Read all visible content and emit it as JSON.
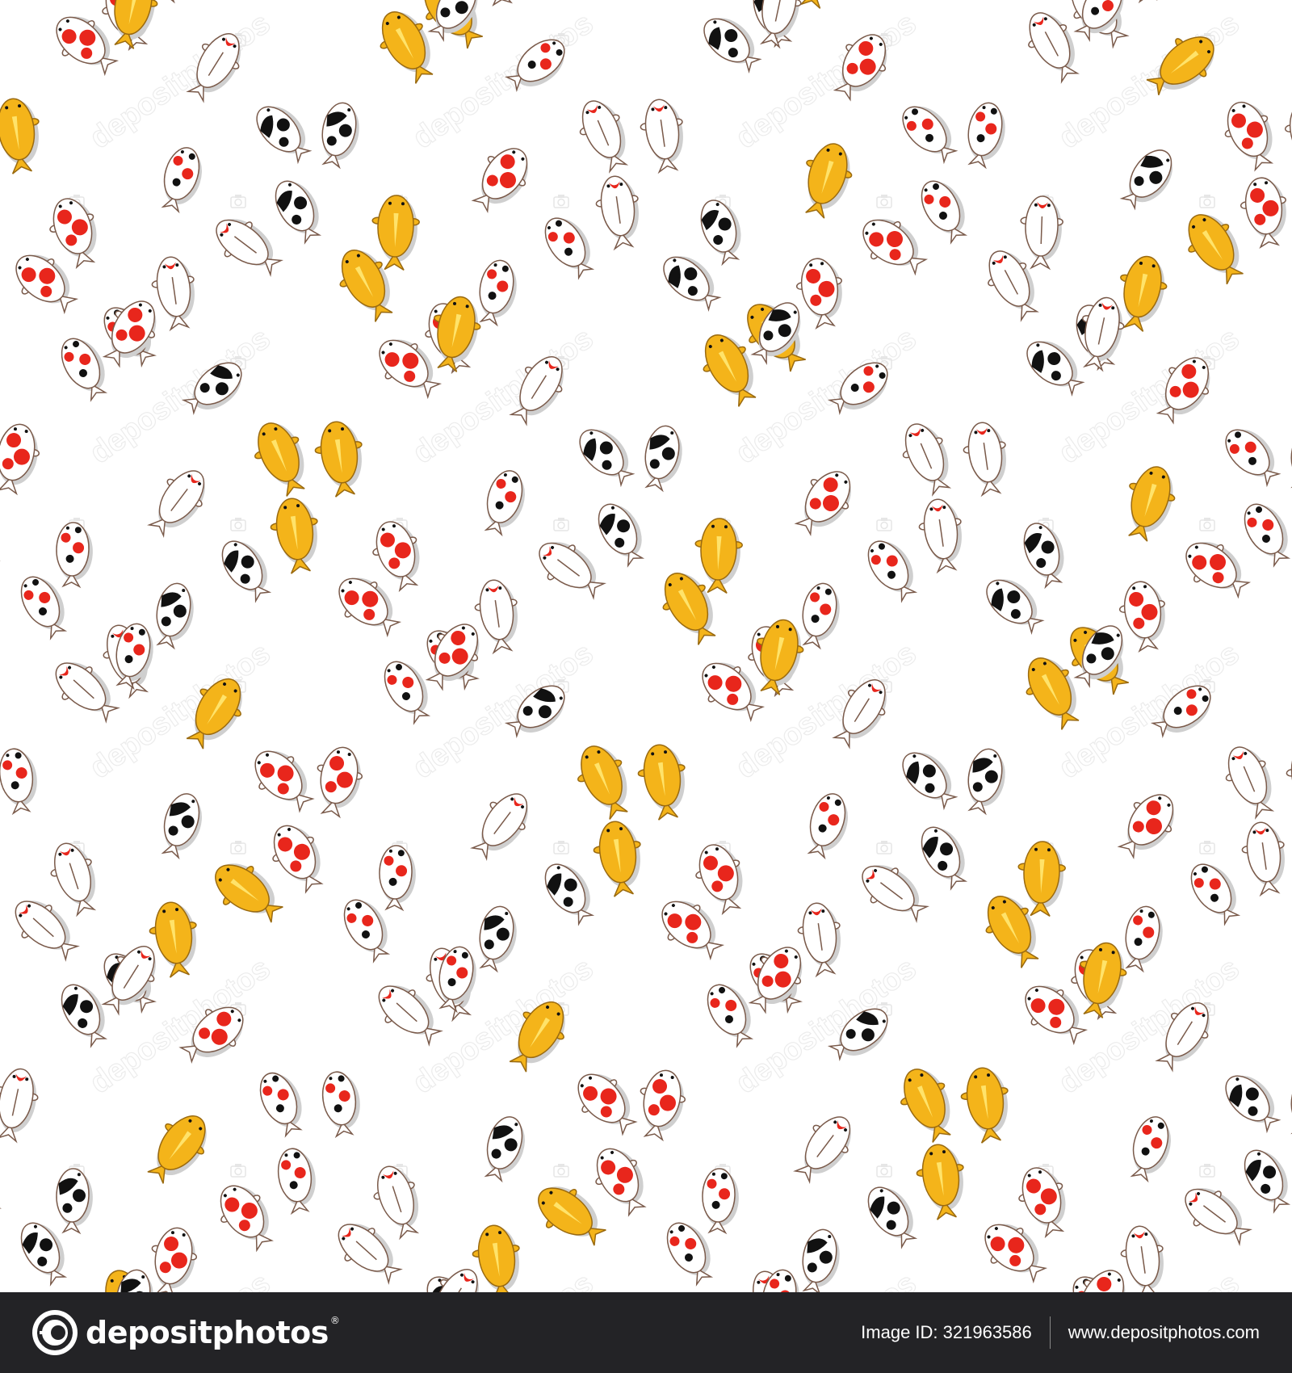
{
  "pattern": {
    "background": "#ffffff",
    "fish_kinds": [
      "kohaku",
      "shiro",
      "ogon",
      "tancho",
      "bekko"
    ],
    "colors": {
      "red": "#e8261c",
      "gold": "#f4b41a",
      "black": "#111111",
      "outline": "#7a5a4a",
      "shadow": "#cfcfcf"
    }
  },
  "watermark": {
    "text": "depositphotos",
    "icon": "camera-icon"
  },
  "footer": {
    "background": "#232326",
    "logo_icon": "depositphotos-logo-icon",
    "logo_text": "depositphotos",
    "logo_mark": "®",
    "image_id_label": "Image ID: 321963586",
    "site_url": "www.depositphotos.com"
  }
}
